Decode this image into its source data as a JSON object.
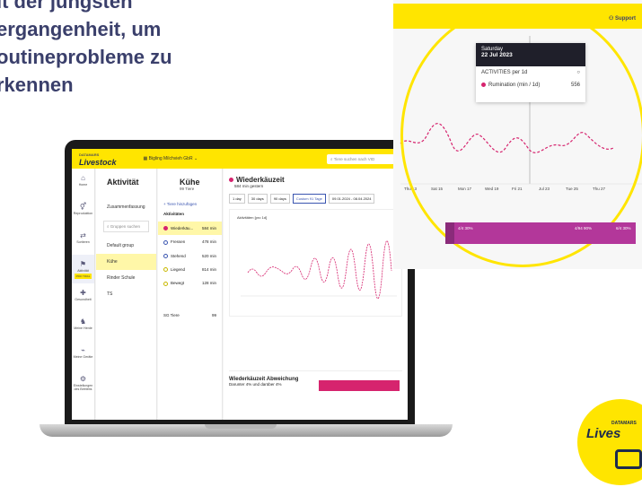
{
  "headline": {
    "lines": [
      "it der jüngsten",
      "ergangenheit, um",
      "outineprobleme zu",
      "rkennen"
    ]
  },
  "app": {
    "logo_small": "DATAMARS",
    "logo": "Livestock",
    "farm": "Bigling Milchvieh GbR",
    "search_placeholder": "Tiere suchen nach VID"
  },
  "rail": [
    {
      "label": "Home",
      "icon": "home-icon"
    },
    {
      "label": "Reproduktion",
      "icon": "reproduction-icon"
    },
    {
      "label": "Sortieren",
      "icon": "sort-icon"
    },
    {
      "label": "Aktivität",
      "icon": "activity-icon",
      "badge": "PRO TRIAL"
    },
    {
      "label": "Gesundheit",
      "icon": "health-icon"
    },
    {
      "label": "Meine Herde",
      "icon": "herd-icon"
    },
    {
      "label": "Meine Geräte",
      "icon": "devices-icon"
    },
    {
      "label": "Einstellungen des Betriebs",
      "icon": "settings-icon"
    }
  ],
  "col1": {
    "title": "Aktivität",
    "summary": "Zusammenfassung",
    "search": "Gruppen suchen",
    "items": [
      "Default group",
      "Kühe",
      "Rinder Schule",
      "TS"
    ]
  },
  "col2": {
    "title": "Kühe",
    "sub": "99 Tiere",
    "add": "+ Tiere hinzufügen",
    "activities_title": "Aktivitäten",
    "rows": [
      {
        "label": "Wiederkäu...",
        "value": "584 min"
      },
      {
        "label": "Fressen",
        "value": "478 min"
      },
      {
        "label": "Stehend",
        "value": "520 min"
      },
      {
        "label": "Liegend",
        "value": "814 min"
      },
      {
        "label": "Bewegt",
        "value": "128 min"
      }
    ],
    "footer_label": "SG Tiere",
    "footer_value": "99"
  },
  "main": {
    "title": "Wiederkäuzeit",
    "sub": "584 min gestern",
    "periods": [
      "1 day",
      "30 days",
      "90 days",
      "Custom 91 Tage"
    ],
    "range": "09.01.2024 - 08.04.2024",
    "chart_label": "Aktivitäten [pro 1d]",
    "deviation_title": "Wiederkäuzeit Abweichung",
    "deviation_inputs": "Darunter  4%  und darüber  4%",
    "tiere": "Tiere",
    "tiere_search": "Tiere suchen"
  },
  "zoom": {
    "support": "Support",
    "tooltip_day": "Saturday",
    "tooltip_date": "22 Jul 2023",
    "tooltip_metric": "ACTIVITIES per 1d",
    "tooltip_series": "Rumination (min / 1d)",
    "tooltip_value": "556",
    "xticks": [
      "Thu 13",
      "Sat 15",
      "Mon 17",
      "Wed 19",
      "Fri 21",
      "Jul 23",
      "Tue 25",
      "Thu 27"
    ],
    "bar_segments": [
      "4/4 30%",
      "4/94 90%",
      "6/4 30%"
    ],
    "bar_left": "4/9",
    "bar_right": "8/0"
  },
  "brand": {
    "small": "DATAMARS",
    "name": "Lives"
  },
  "colors": {
    "yellow": "#ffe500",
    "navy": "#3a3f6b",
    "pink": "#d6246e",
    "magenta": "#b3379a"
  }
}
